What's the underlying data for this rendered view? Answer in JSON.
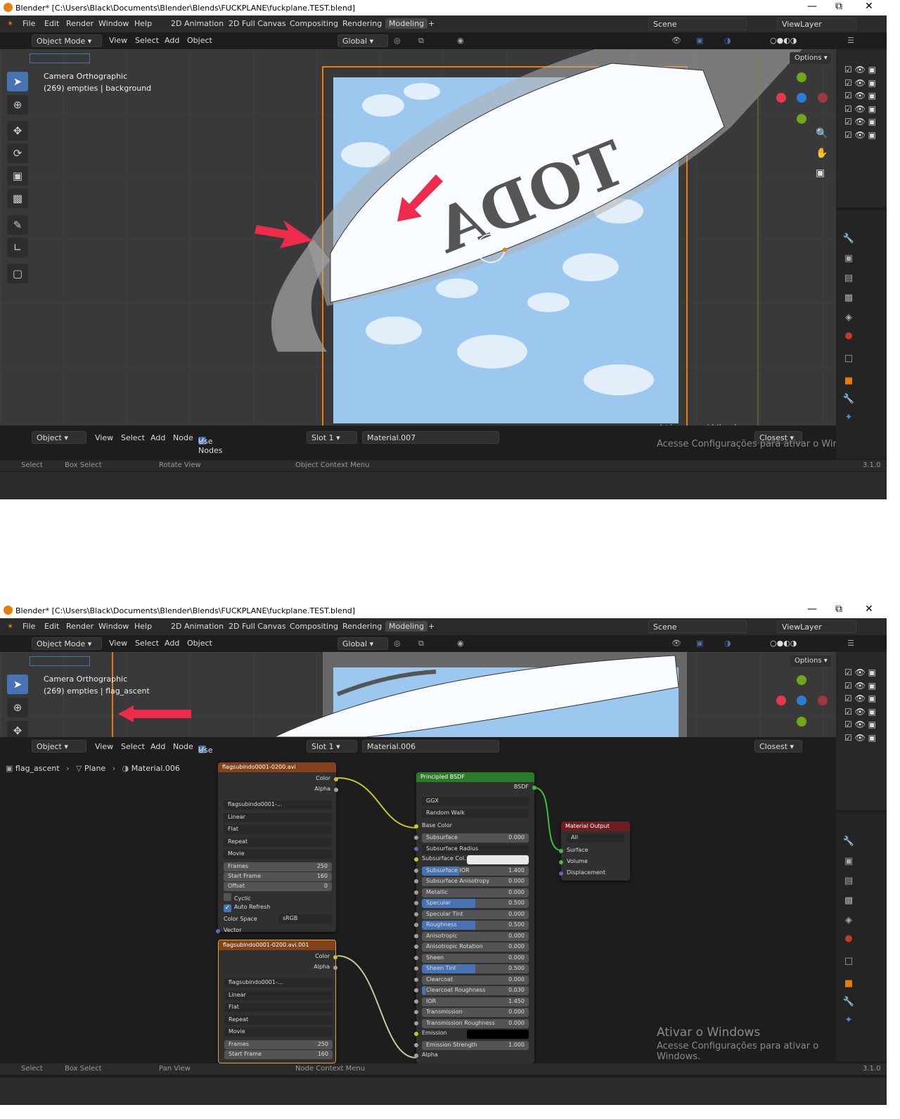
{
  "window_title": "Blender* [C:\\Users\\Black\\Documents\\Blender\\Blends\\FUCKPLANE\\fuckplane.TEST.blend]",
  "menu": [
    "File",
    "Edit",
    "Render",
    "Window",
    "Help"
  ],
  "workspaces": [
    "2D Animation",
    "2D Full Canvas",
    "Compositing",
    "Rendering",
    "Modeling"
  ],
  "active_workspace": "Modeling",
  "scene": "Scene",
  "view_layer": "ViewLayer",
  "viewport_header": {
    "mode": "Object Mode",
    "menus": [
      "View",
      "Select",
      "Add",
      "Object"
    ],
    "orientation": "Global",
    "options": "Options"
  },
  "screenshot1": {
    "overlay_line1": "Camera Orthographic",
    "overlay_line2": "(269) empties | background",
    "node_header": {
      "mode": "Object",
      "menus": [
        "View",
        "Select",
        "Add",
        "Node"
      ],
      "use_nodes": "Use Nodes",
      "slot": "Slot 1",
      "material": "Material.007",
      "snap": "Closest"
    },
    "status": [
      "Select",
      "Box Select",
      "Rotate View",
      "Object Context Menu"
    ],
    "version": "3.1.0",
    "banner_text": "TODA"
  },
  "screenshot2": {
    "overlay_line1": "Camera Orthographic",
    "overlay_line2": "(269) empties | flag_ascent",
    "node_header": {
      "mode": "Object",
      "menus": [
        "View",
        "Select",
        "Add",
        "Node"
      ],
      "use_nodes": "Use Nodes",
      "slot": "Slot 1",
      "material": "Material.006",
      "snap": "Closest"
    },
    "breadcrumb": [
      "flag_ascent",
      "Plane",
      "Material.006"
    ],
    "status": [
      "Select",
      "Box Select",
      "Pan View",
      "Node Context Menu"
    ],
    "version": "3.1.0"
  },
  "image_node_1": {
    "title": "flagsubindo0001-0200.avi",
    "outputs": [
      "Color",
      "Alpha"
    ],
    "image_name": "flagsubindo0001-...",
    "interpolation": "Linear",
    "projection": "Flat",
    "extension": "Repeat",
    "source": "Movie",
    "frames_label": "Frames",
    "frames": "250",
    "start_label": "Start Frame",
    "start": "160",
    "offset_label": "Offset",
    "offset": "0",
    "cyclic": "Cyclic",
    "auto_refresh": "Auto Refresh",
    "color_space_label": "Color Space",
    "color_space": "sRGB",
    "vector": "Vector"
  },
  "image_node_2": {
    "title": "flagsubindo0001-0200.avi.001",
    "outputs": [
      "Color",
      "Alpha"
    ],
    "image_name": "flagsubindo0001-...",
    "interpolation": "Linear",
    "projection": "Flat",
    "extension": "Repeat",
    "source": "Movie",
    "frames_label": "Frames",
    "frames": "250",
    "start_label": "Start Frame",
    "start": "160"
  },
  "bsdf_node": {
    "title": "Principled BSDF",
    "output": "BSDF",
    "distribution": "GGX",
    "subsurface_method": "Random Walk",
    "base_color": "Base Color",
    "rows": [
      {
        "label": "Subsurface",
        "value": "0.000",
        "fill": 0
      },
      {
        "label": "Subsurface Radius",
        "value": "",
        "dd": true
      },
      {
        "label": "Subsurface Col...",
        "value": "",
        "swatch": "#e8e8e8"
      },
      {
        "label": "Subsurface IOR",
        "value": "1.400",
        "fill": 0.35
      },
      {
        "label": "Subsurface Anisotropy",
        "value": "0.000",
        "fill": 0
      },
      {
        "label": "Metallic",
        "value": "0.000",
        "fill": 0
      },
      {
        "label": "Specular",
        "value": "0.500",
        "fill": 0.5
      },
      {
        "label": "Specular Tint",
        "value": "0.000",
        "fill": 0
      },
      {
        "label": "Roughness",
        "value": "0.500",
        "fill": 0.5
      },
      {
        "label": "Anisotropic",
        "value": "0.000",
        "fill": 0
      },
      {
        "label": "Anisotropic Rotation",
        "value": "0.000",
        "fill": 0
      },
      {
        "label": "Sheen",
        "value": "0.000",
        "fill": 0
      },
      {
        "label": "Sheen Tint",
        "value": "0.500",
        "fill": 0.5
      },
      {
        "label": "Clearcoat",
        "value": "0.000",
        "fill": 0
      },
      {
        "label": "Clearcoat Roughness",
        "value": "0.030",
        "fill": 0.03
      },
      {
        "label": "IOR",
        "value": "1.450",
        "fill": 0
      },
      {
        "label": "Transmission",
        "value": "0.000",
        "fill": 0
      },
      {
        "label": "Transmission Roughness",
        "value": "0.000",
        "fill": 0
      },
      {
        "label": "Emission",
        "value": "",
        "swatch": "#000000"
      },
      {
        "label": "Emission Strength",
        "value": "1.000",
        "fill": 0
      },
      {
        "label": "Alpha",
        "value": "",
        "plain": true
      }
    ]
  },
  "output_node": {
    "title": "Material Output",
    "target": "All",
    "inputs": [
      "Surface",
      "Volume",
      "Displacement"
    ]
  },
  "watermark": {
    "line1": "Ativar o Windows",
    "line2": "Acesse Configurações para ativar o Windows."
  },
  "colors": {
    "accent": "#4772b3",
    "selection_orange": "#e87d0d",
    "image_node_header": "#83431a",
    "shader_node_header": "#2a7a2a",
    "output_node_header": "#6e1e1e",
    "arrow_red": "#ee2b4a"
  }
}
